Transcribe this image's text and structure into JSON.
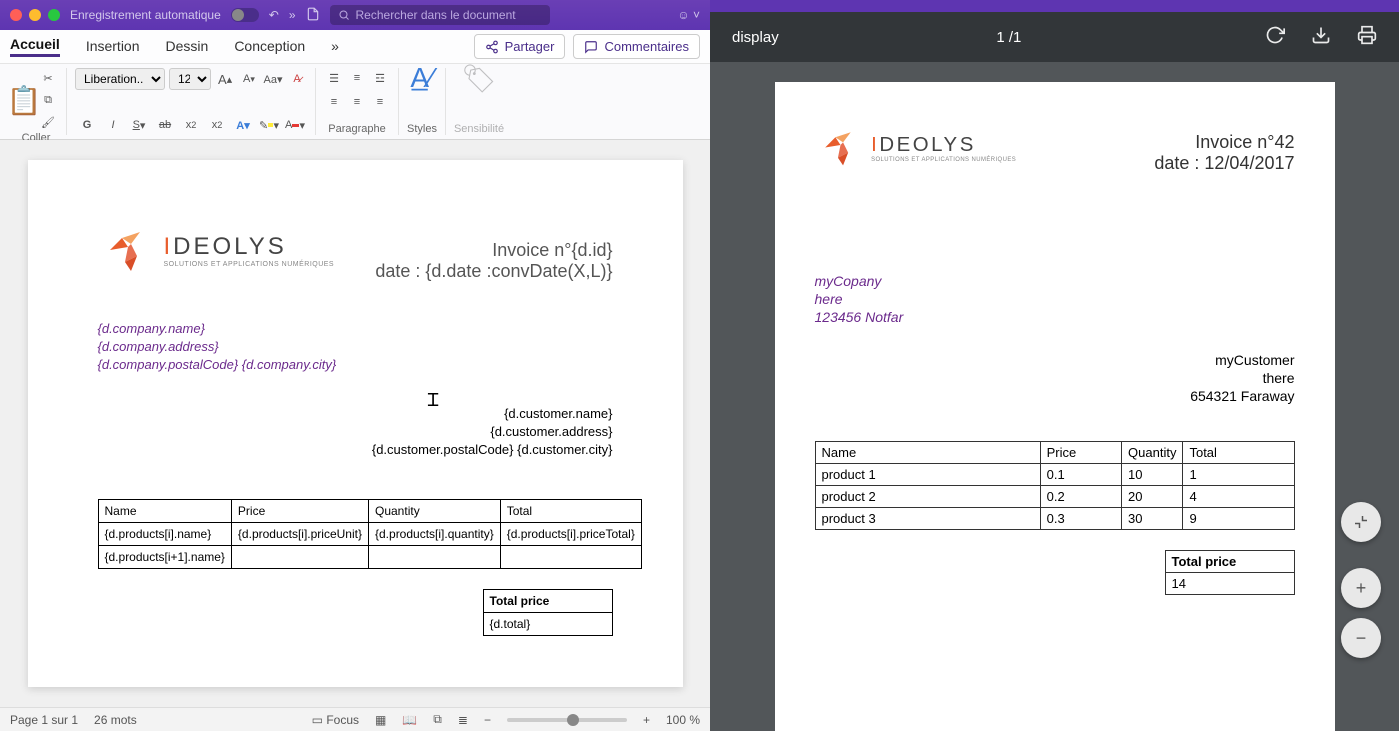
{
  "word": {
    "titlebar": {
      "autosave_label": "Enregistrement automatique",
      "search_placeholder": "Rechercher dans le document",
      "undo_icon": "↶"
    },
    "tabs": {
      "accueil": "Accueil",
      "insertion": "Insertion",
      "dessin": "Dessin",
      "conception": "Conception",
      "more": "»"
    },
    "actions": {
      "partager": "Partager",
      "commentaires": "Commentaires"
    },
    "ribbon": {
      "coller": "Coller",
      "font_name": "Liberation...",
      "font_size": "12",
      "paragraphe": "Paragraphe",
      "styles": "Styles",
      "sensibilite": "Sensibilité"
    },
    "statusbar": {
      "page": "Page 1 sur 1",
      "words": "26 mots",
      "focus": "Focus",
      "zoom": "100 %"
    }
  },
  "template": {
    "logo_text_i": "I",
    "logo_text_rest": "DEOLYS",
    "logo_sub": "SOLUTIONS ET APPLICATIONS NUMÉRIQUES",
    "invoice_line": "Invoice n°{d.id}",
    "date_line": "date : {d.date :convDate(X,L)}",
    "company_name": "{d.company.name}",
    "company_address": "{d.company.address}",
    "company_postal_city": "{d.company.postalCode} {d.company.city}",
    "customer_name": "{d.customer.name}",
    "customer_address": "{d.customer.address}",
    "customer_postal_city": "{d.customer.postalCode} {d.customer.city}",
    "table": {
      "headers": {
        "name": "Name",
        "price": "Price",
        "quantity": "Quantity",
        "total": "Total"
      },
      "row1": {
        "name": "{d.products[i].name}",
        "price": "{d.products[i].priceUnit}",
        "quantity": "{d.products[i].quantity}",
        "total": "{d.products[i].priceTotal}"
      },
      "row2_name": "{d.products[i+1].name}"
    },
    "total_label": "Total price",
    "total_value": "{d.total}"
  },
  "pdf": {
    "title": "display",
    "page_indicator": "1 /1",
    "invoice_line": "Invoice n°42",
    "date_line": "date : 12/04/2017",
    "company": {
      "name": "myCopany",
      "address": "here",
      "postal_city": "123456 Notfar"
    },
    "customer": {
      "name": "myCustomer",
      "address": "there",
      "postal_city": "654321 Faraway"
    },
    "headers": {
      "name": "Name",
      "price": "Price",
      "quantity": "Quantity",
      "total": "Total"
    },
    "rows": [
      {
        "name": "product 1",
        "price": "0.1",
        "quantity": "10",
        "total": "1"
      },
      {
        "name": "product 2",
        "price": "0.2",
        "quantity": "20",
        "total": "4"
      },
      {
        "name": "product 3",
        "price": "0.3",
        "quantity": "30",
        "total": "9"
      }
    ],
    "total_label": "Total price",
    "total_value": "14"
  }
}
